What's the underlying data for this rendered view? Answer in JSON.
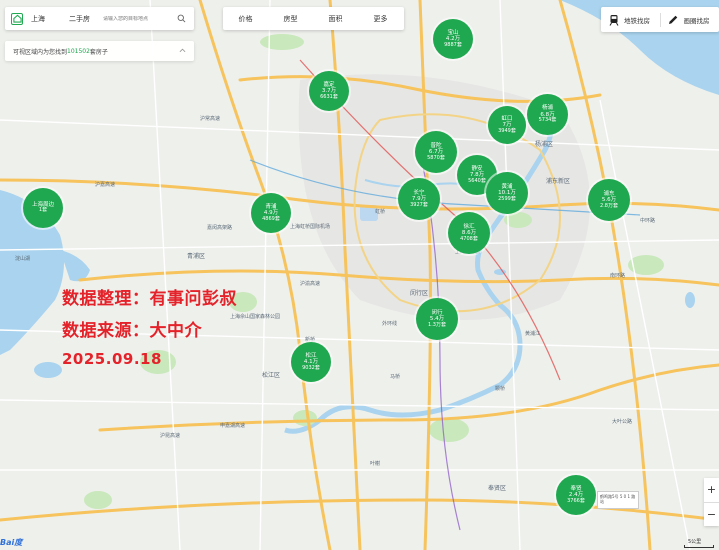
{
  "search": {
    "city": "上海",
    "house_type": "二手房",
    "placeholder": "请输入您的目标地点"
  },
  "filters": [
    "价格",
    "房型",
    "面积",
    "更多"
  ],
  "result": {
    "prefix": "可视区域内为您找到",
    "count": "101502",
    "suffix": "套房子"
  },
  "top_right": {
    "metro": "地铁找房",
    "draw": "画圈找房"
  },
  "districts": [
    {
      "name": "宝山",
      "price": "4.2万",
      "count": "9887套"
    },
    {
      "name": "嘉定",
      "price": "3.7万",
      "count": "6631套"
    },
    {
      "name": "虹口",
      "price": "7万",
      "count": "3949套"
    },
    {
      "name": "杨浦",
      "price": "6.8万",
      "count": "5734套"
    },
    {
      "name": "普陀",
      "price": "6.7万",
      "count": "5870套"
    },
    {
      "name": "静安",
      "price": "7.8万",
      "count": "5640套"
    },
    {
      "name": "上海周边",
      "price": "",
      "count": "1套"
    },
    {
      "name": "青浦",
      "price": "4.9万",
      "count": "4869套"
    },
    {
      "name": "长宁",
      "price": "7.9万",
      "count": "3927套"
    },
    {
      "name": "黄浦",
      "price": "10.1万",
      "count": "2599套"
    },
    {
      "name": "浦东",
      "price": "5.6万",
      "count": "2.8万套"
    },
    {
      "name": "徐汇",
      "price": "8.6万",
      "count": "4708套"
    },
    {
      "name": "闵行",
      "price": "5.4万",
      "count": "1.3万套"
    },
    {
      "name": "松江",
      "price": "4.1万",
      "count": "9032套"
    },
    {
      "name": "奉贤",
      "price": "2.4万",
      "count": "3766套"
    }
  ],
  "overlay": {
    "line1": "数据整理：有事问彭叔",
    "line2": "数据来源：大中介",
    "line3": "2025.09.18"
  },
  "map_labels": [
    "杨浦区",
    "浦东新区",
    "青浦区",
    "松江区",
    "闵行区",
    "奉贤区",
    "上海虹桥国际机场",
    "沪嘉高速",
    "沪常高速",
    "嘉闵高架路",
    "中环路",
    "南环路",
    "外环线",
    "沪渝高速",
    "沪昆高速",
    "申嘉湖高速",
    "颛桥",
    "大叶公路",
    "上海佘山国家森林公园",
    "上海植物园",
    "淀山湖",
    "新桥",
    "马桥",
    "叶榭",
    "虹桥",
    "黄浦江"
  ],
  "station_tip": "鹤鸣路5号 5 0 1 路站",
  "scale": "5公里",
  "logo": "Bai度",
  "colors": {
    "bubble": "#1fa84f",
    "overlay_text": "#e4222a",
    "water": "#a9d3ee",
    "park": "#c9e8bb",
    "highway": "#f6c35c"
  }
}
